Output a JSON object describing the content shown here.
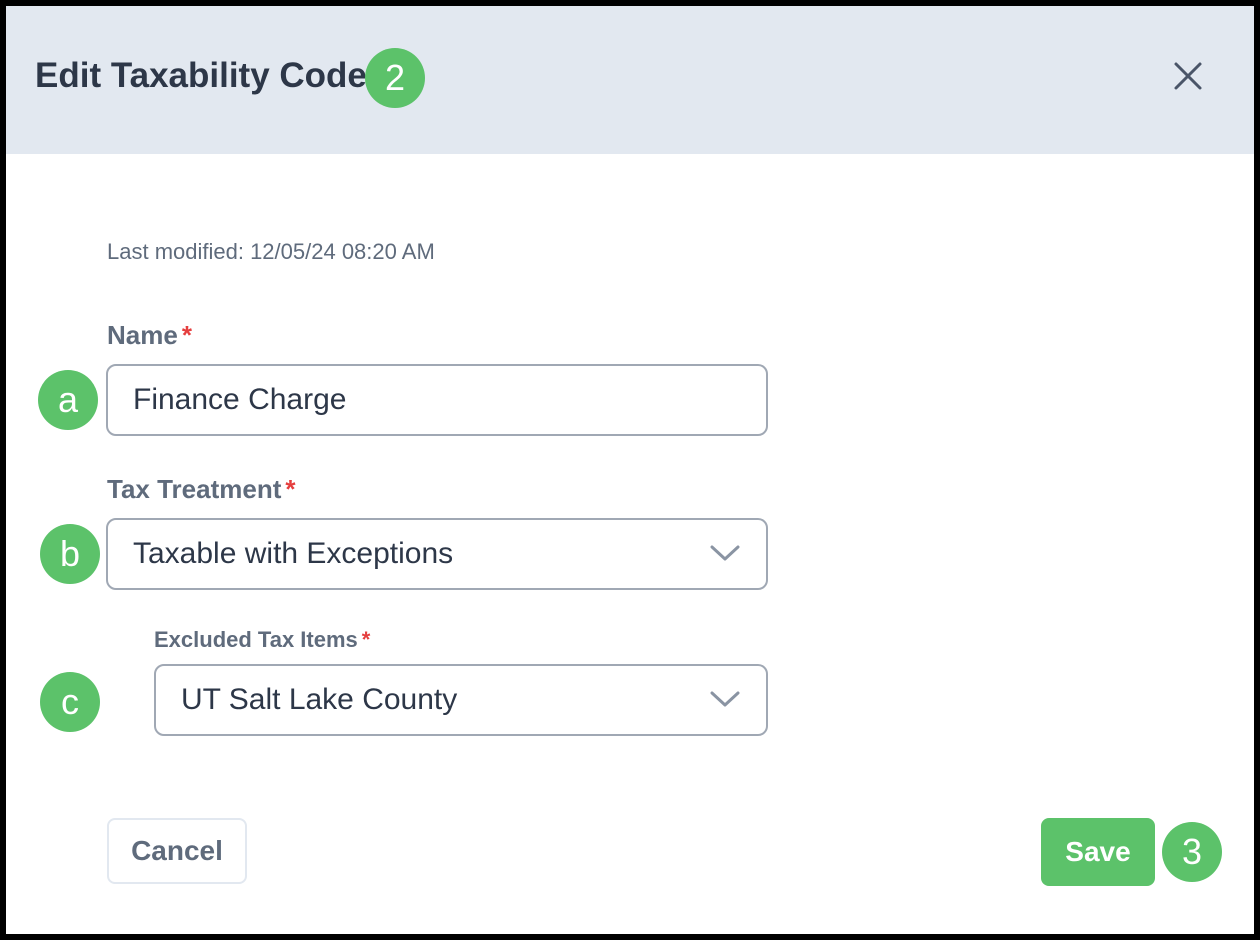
{
  "dialog": {
    "title": "Edit Taxability Code",
    "title_step": "2",
    "close_icon": "close-icon",
    "last_modified": "Last modified: 12/05/24 08:20 AM"
  },
  "form": {
    "name": {
      "label": "Name",
      "required_mark": "*",
      "value": "Finance Charge",
      "step": "a"
    },
    "tax_treatment": {
      "label": "Tax Treatment",
      "required_mark": "*",
      "value": "Taxable with Exceptions",
      "step": "b",
      "icon": "chevron-down-icon"
    },
    "excluded_tax_items": {
      "label": "Excluded Tax Items",
      "required_mark": "*",
      "value": "UT Salt Lake County",
      "step": "c",
      "icon": "chevron-down-icon"
    }
  },
  "footer": {
    "cancel_label": "Cancel",
    "save_label": "Save",
    "save_step": "3"
  },
  "colors": {
    "header_bg": "#e2e8f0",
    "accent_green": "#5cc26a",
    "required_red": "#e53e3e",
    "text_dark": "#2d3748",
    "text_muted": "#5f6b7c"
  }
}
